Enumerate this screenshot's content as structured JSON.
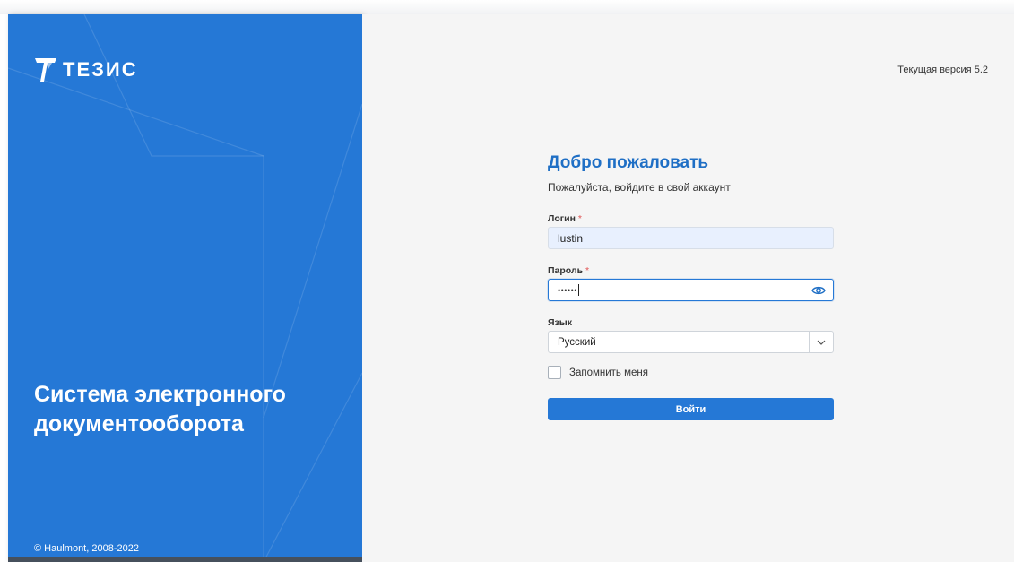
{
  "brand": {
    "name": "ТЕЗИС",
    "system_title_line1": "Система электронного",
    "system_title_line2": "документооборота",
    "copyright": "© Haulmont, 2008-2022"
  },
  "header": {
    "version": "Текущая версия 5.2"
  },
  "form": {
    "welcome": "Добро пожаловать",
    "subtitle": "Пожалуйста, войдите в свой аккаунт",
    "login_label": "Логин",
    "login_value": "lustin",
    "password_label": "Пароль",
    "password_value": "••••••",
    "required_mark": "*",
    "language_label": "Язык",
    "language_value": "Русский",
    "remember_label": "Запомнить меня",
    "remember_checked": false,
    "submit_label": "Войти"
  },
  "icons": {
    "logo": "tezis-logo-icon",
    "password_toggle": "eye-icon",
    "dropdown": "chevron-down-icon"
  },
  "colors": {
    "brand_blue": "#2578d6",
    "heading_blue": "#1f6fc5",
    "required_red": "#e05555",
    "background": "#f5f5f5"
  }
}
